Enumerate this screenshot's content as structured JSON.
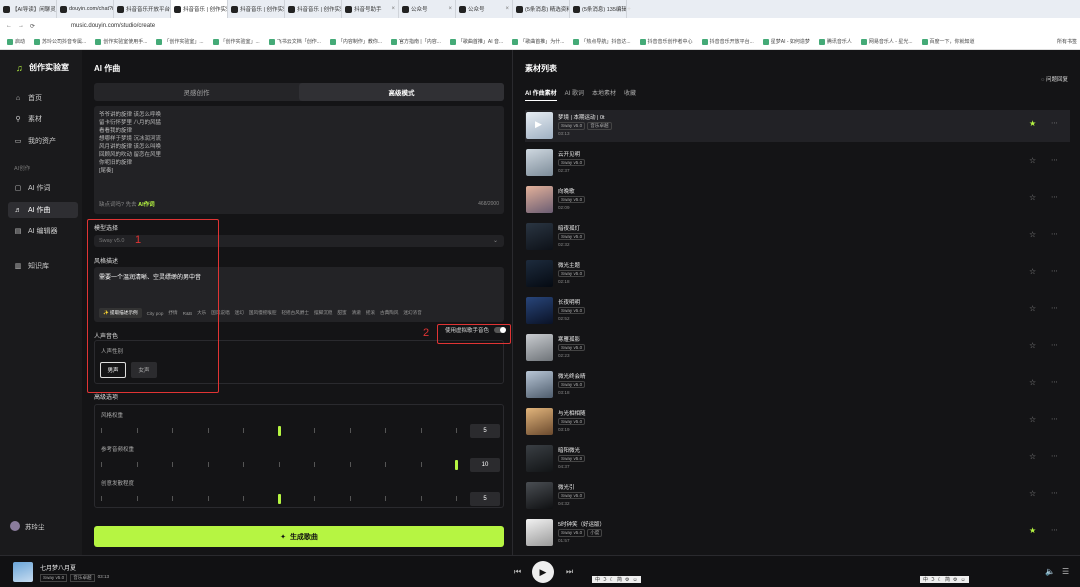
{
  "browser": {
    "tabs": [
      "【AI导读】闲聊灵杂谈",
      "douyin.com/chat?isP",
      "抖音音乐开放平台 | 音",
      "抖音音乐 | 创作实验室",
      "抖音音乐 | 创作实验",
      "抖音音乐 | 创作实验",
      "抖音号助手",
      "公众号",
      "公众号",
      "(5条消息) 精选资料-13",
      "(5条消息) 135编辑器引"
    ],
    "new_tab": "+",
    "url": "music.douyin.com/studio/create",
    "bookmarks": [
      "启动",
      "苏玲公司抖音专属...",
      "创作实验室使用手...",
      "「创作实验室」...",
      "「创作实验室」...",
      "飞书云文档「创作...",
      "「内容制作」教你...",
      "官方指南 |「内容...",
      "「歌曲首推」AI 音...",
      "「歌曲首推」为什...",
      "「热点导航」抖音达...",
      "抖音音乐创作者中心",
      "抖音音乐开放平台...",
      "星梦AI - 如何造梦",
      "腾讯音乐人",
      "网易音乐人 - 星光...",
      "百度一下，你就知道"
    ],
    "other_bookmarks": "所有书签"
  },
  "sidebar": {
    "logo": "创作实验室",
    "home": "首页",
    "material": "素材",
    "assets": "我的资产",
    "section": "AI创作",
    "lyrics": "AI 作词",
    "compose": "AI 作曲",
    "edit": "AI 编辑器",
    "knowledge": "知识库",
    "user": "苏玲尘"
  },
  "main": {
    "title": "AI 作曲",
    "tab_inspire": "灵感创作",
    "tab_advanced": "高级模式",
    "lyrics": [
      "爷爷讲的旋律 该怎么呼唤",
      "留卡衍怀梦里 八月的风猛",
      "看看我的旋律",
      "想哪样于梦境 沉冰润河流",
      "风月讲的旋律 该怎么叫唤",
      "回顾风的吹动 留恋在风里",
      "你呢旧的旋律",
      "[尾奏]"
    ],
    "lyrics_hint": "缺点词吗? 先去",
    "lyrics_hint_link": "AI作词",
    "lyrics_count": "468/2000",
    "model_label": "模型选择",
    "model_value": "Sway v5.0",
    "style_label": "风格描述",
    "style_text": "需要一个温润清晰、空灵缥缈的男中音",
    "style_gen": "✨ 提取描述示例",
    "style_chips": [
      "City pop",
      "抒情",
      "R&B",
      "大乐",
      "国风说唱",
      "迷幻",
      "国风慢摇喉腔",
      "轻摇古风爵士",
      "摆脚沉稳",
      "甜蜜",
      "清澈",
      "摇滚",
      "古典陶风",
      "迷幻浓音"
    ],
    "vocal_label": "人声音色",
    "vocal_toggle": "使用虚拟歌手音色",
    "gender_label": "人声性别",
    "male": "男声",
    "female": "女声",
    "mix_label": "高级选项",
    "sliders": [
      {
        "label": "风格权重",
        "value": "5",
        "fraction": 0.5
      },
      {
        "label": "参考音频权重",
        "value": "10",
        "fraction": 1.0
      },
      {
        "label": "创意发散程度",
        "value": "5",
        "fraction": 0.5
      }
    ],
    "generate": "生成歌曲",
    "annotation_1": "1",
    "annotation_2": "2"
  },
  "library": {
    "title": "素材列表",
    "tabs": [
      "AI 作曲素材",
      "AI 歌词",
      "本地素材",
      "收藏"
    ],
    "items": [
      {
        "title": "梦境 | 本期运动 | 0t",
        "meta": [
          "Sway v5.0",
          "音乐卓越"
        ],
        "dur": "03:13",
        "fav": true,
        "c1": "#e8eef4",
        "c2": "#9fb0c2"
      },
      {
        "title": "云开见明",
        "meta": [
          "Sway v5.0"
        ],
        "dur": "02:37",
        "fav": false,
        "c1": "#cfd8e0",
        "c2": "#7d8c99"
      },
      {
        "title": "向晚歌",
        "meta": [
          "Sway v5.0"
        ],
        "dur": "02:09",
        "fav": false,
        "c1": "#e3b19a",
        "c2": "#6b5d73"
      },
      {
        "title": "暗夜孤灯",
        "meta": [
          "Sway v5.0"
        ],
        "dur": "02:32",
        "fav": false,
        "c1": "#2a3542",
        "c2": "#0d1118"
      },
      {
        "title": "微光主题",
        "meta": [
          "Sway v5.0"
        ],
        "dur": "02:18",
        "fav": false,
        "c1": "#1d2b3d",
        "c2": "#050a12"
      },
      {
        "title": "长夜明明",
        "meta": [
          "Sway v5.0"
        ],
        "dur": "02:52",
        "fav": false,
        "c1": "#28457a",
        "c2": "#0a1226"
      },
      {
        "title": "寒雁孤影",
        "meta": [
          "Sway v5.0"
        ],
        "dur": "02:23",
        "fav": false,
        "c1": "#c9ccd0",
        "c2": "#6f7479"
      },
      {
        "title": "微光终会晴",
        "meta": [
          "Sway v5.0"
        ],
        "dur": "03:18",
        "fav": false,
        "c1": "#b8c6d6",
        "c2": "#4f5d6d"
      },
      {
        "title": "与光相相随",
        "meta": [
          "Sway v5.0"
        ],
        "dur": "03:19",
        "fav": false,
        "c1": "#e2b57c",
        "c2": "#6b4a2e"
      },
      {
        "title": "暗阳微光",
        "meta": [
          "Sway v5.0"
        ],
        "dur": "04:37",
        "fav": false,
        "c1": "#3a3f44",
        "c2": "#121416"
      },
      {
        "title": "微光引",
        "meta": [
          "Sway v5.0"
        ],
        "dur": "04:32",
        "fav": false,
        "c1": "#4a4e53",
        "c2": "#0f1012"
      },
      {
        "title": "5时钟笑（好运版）",
        "meta": [
          "Sway v5.0",
          "小度"
        ],
        "dur": "01:57",
        "fav": true,
        "c1": "#f2f2f2",
        "c2": "#9a9a9a"
      }
    ]
  },
  "topright": {
    "feedback": "问题回复"
  },
  "player": {
    "title": "七月梦八月夏",
    "meta": [
      "Sway v5.0",
      "音乐卓越"
    ],
    "time": "03:13",
    "ime": [
      "中",
      "ℑ",
      "☾",
      "简",
      "⚙",
      "☺"
    ]
  },
  "colors": {
    "accent": "#b6f542",
    "annotation": "#e03434"
  }
}
